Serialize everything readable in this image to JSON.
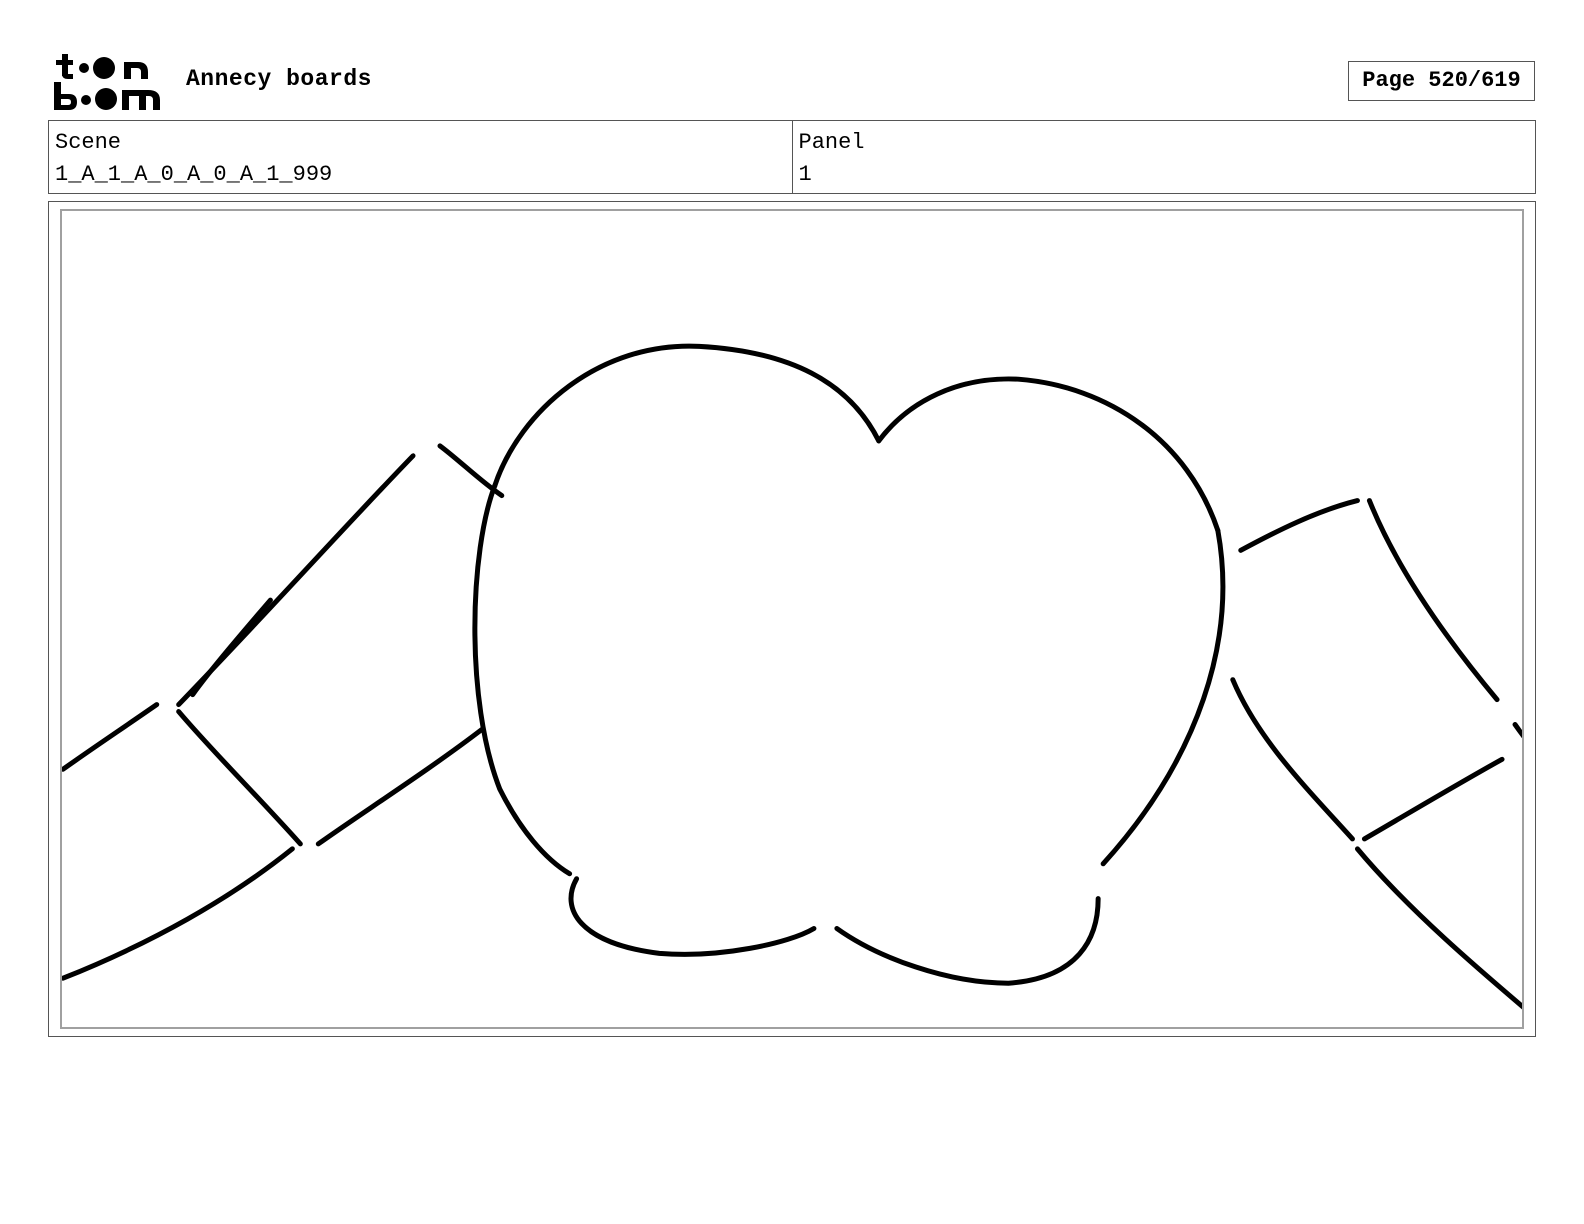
{
  "header": {
    "brand_logo": "toon boom",
    "project_title": "Annecy boards",
    "page_indicator": "Page 520/619"
  },
  "info": {
    "scene_label": "Scene",
    "scene_value": "1_A_1_A_0_A_0_A_1_999",
    "panel_label": "Panel",
    "panel_value": "1"
  },
  "panel_image": {
    "content": "storyboard-sketch"
  }
}
